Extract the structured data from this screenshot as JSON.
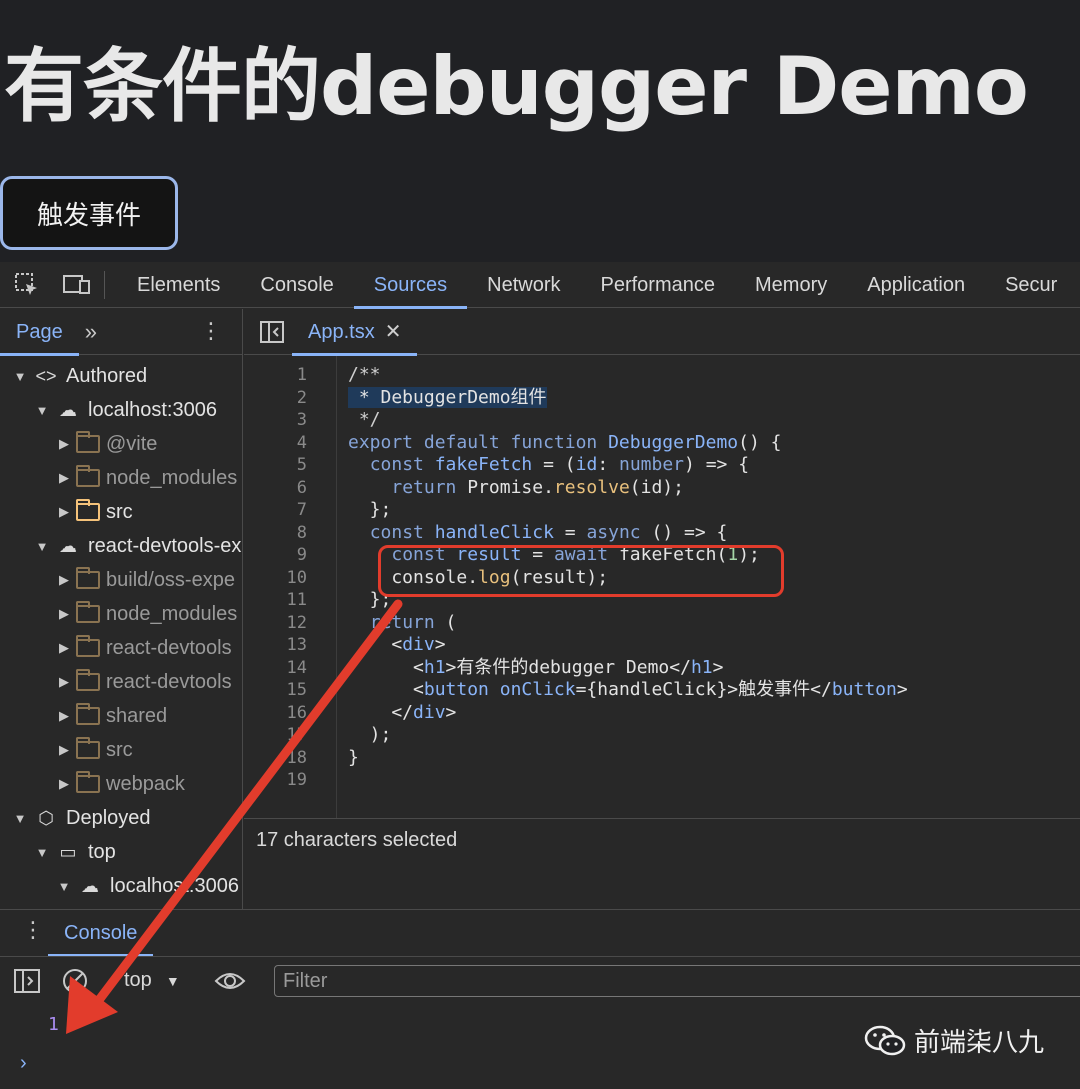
{
  "page": {
    "title": "有条件的debugger Demo",
    "button_label": "触发事件"
  },
  "devtools": {
    "tabs": [
      "Elements",
      "Console",
      "Sources",
      "Network",
      "Performance",
      "Memory",
      "Application",
      "Secur"
    ],
    "active_tab": "Sources",
    "navigator": {
      "tab": "Page",
      "more": "»",
      "tree": [
        {
          "label": "Authored",
          "icon": "code-icon",
          "expanded": true,
          "indent": 0
        },
        {
          "label": "localhost:3006",
          "icon": "cloud-icon",
          "expanded": true,
          "indent": 1
        },
        {
          "label": "@vite",
          "icon": "folder-icon",
          "expanded": false,
          "indent": 2,
          "dim": true
        },
        {
          "label": "node_modules",
          "icon": "folder-icon",
          "expanded": false,
          "indent": 2,
          "dim": true
        },
        {
          "label": "src",
          "icon": "folder-icon",
          "expanded": false,
          "indent": 2,
          "dim": false
        },
        {
          "label": "react-devtools-ex",
          "icon": "cloud-icon",
          "expanded": true,
          "indent": 1
        },
        {
          "label": "build/oss-expe",
          "icon": "folder-icon",
          "expanded": false,
          "indent": 2,
          "dim": true
        },
        {
          "label": "node_modules",
          "icon": "folder-icon",
          "expanded": false,
          "indent": 2,
          "dim": true
        },
        {
          "label": "react-devtools",
          "icon": "folder-icon",
          "expanded": false,
          "indent": 2,
          "dim": true
        },
        {
          "label": "react-devtools",
          "icon": "folder-icon",
          "expanded": false,
          "indent": 2,
          "dim": true
        },
        {
          "label": "shared",
          "icon": "folder-icon",
          "expanded": false,
          "indent": 2,
          "dim": true
        },
        {
          "label": "src",
          "icon": "folder-icon",
          "expanded": false,
          "indent": 2,
          "dim": true
        },
        {
          "label": "webpack",
          "icon": "folder-icon",
          "expanded": false,
          "indent": 2,
          "dim": true
        },
        {
          "label": "Deployed",
          "icon": "cube-icon",
          "expanded": true,
          "indent": 0
        },
        {
          "label": "top",
          "icon": "frame-icon",
          "expanded": true,
          "indent": 1
        },
        {
          "label": "localhost:3006",
          "icon": "cloud-icon",
          "expanded": true,
          "indent": 2
        }
      ]
    },
    "editor": {
      "file_tab": "App.tsx",
      "close": "✕",
      "line_numbers": [
        "1",
        "2",
        "3",
        "4",
        "5",
        "6",
        "7",
        "8",
        "9",
        "10",
        "11",
        "12",
        "13",
        "14",
        "15",
        "16",
        "17",
        "18",
        "19"
      ],
      "status": "17 characters selected"
    },
    "console": {
      "tab": "Console",
      "context": "top",
      "filter_placeholder": "Filter",
      "output": "1",
      "prompt": "›"
    }
  },
  "watermark": "前端柒八九",
  "colors": {
    "accent": "#8ab4f8",
    "highlight": "#e23c2c"
  }
}
